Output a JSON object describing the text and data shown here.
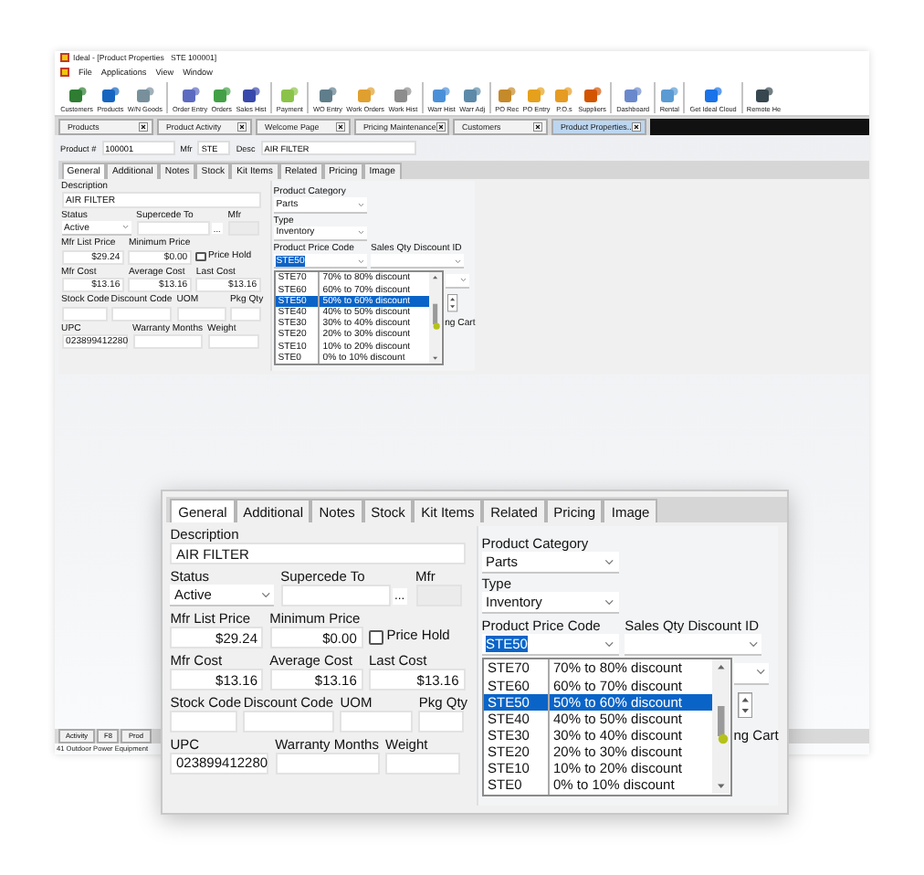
{
  "window": {
    "title": "Ideal - [Product Properties   STE 100001]",
    "menu": [
      "File",
      "Applications",
      "View",
      "Window"
    ],
    "toolbar_groups": [
      [
        "Customers",
        "Products",
        "W/N Goods"
      ],
      [
        "Order Entry",
        "Orders",
        "Sales Hist"
      ],
      [
        "Payment"
      ],
      [
        "WO Entry",
        "Work Orders",
        "Work Hist"
      ],
      [
        "Warr Hist",
        "Warr Adj"
      ],
      [
        "PO Rec",
        "PO Entry",
        "P.O.s",
        "Suppliers"
      ],
      [
        "Dashboard"
      ],
      [
        "Rental"
      ],
      [
        "Get Ideal Cloud"
      ],
      [
        "Remote He"
      ]
    ],
    "doc_tabs": [
      {
        "label": "Products",
        "selected": false
      },
      {
        "label": "Product Activity",
        "selected": false
      },
      {
        "label": "Welcome Page",
        "selected": false
      },
      {
        "label": "Pricing Maintenance",
        "selected": false
      },
      {
        "label": "Customers",
        "selected": false
      },
      {
        "label": "Product Properties..",
        "selected": true
      }
    ],
    "product_bar": {
      "product_label": "Product #",
      "product_value": "100001",
      "mfr_label": "Mfr",
      "mfr_value": "STE",
      "desc_label": "Desc",
      "desc_value": "AIR FILTER"
    },
    "form": {
      "tabs": [
        {
          "label": "General",
          "selected": true
        },
        {
          "label": "Additional",
          "selected": false
        },
        {
          "label": "Notes",
          "selected": false
        },
        {
          "label": "Stock",
          "selected": false
        },
        {
          "label": "Kit Items",
          "selected": false
        },
        {
          "label": "Related",
          "selected": false
        },
        {
          "label": "Pricing",
          "selected": false
        },
        {
          "label": "Image",
          "selected": false
        }
      ],
      "description": {
        "label": "Description",
        "value": "AIR FILTER"
      },
      "status": {
        "label": "Status",
        "value": "Active"
      },
      "supercede_to": {
        "label": "Supercede To",
        "button": "..."
      },
      "mfr": {
        "label": "Mfr"
      },
      "mfr_list_price": {
        "label": "Mfr List Price",
        "value": "$29.24"
      },
      "minimum_price": {
        "label": "Minimum Price",
        "value": "$0.00"
      },
      "price_hold": {
        "label": "Price Hold",
        "checked": false
      },
      "mfr_cost": {
        "label": "Mfr Cost",
        "value": "$13.16"
      },
      "average_cost": {
        "label": "Average Cost",
        "value": "$13.16"
      },
      "last_cost": {
        "label": "Last Cost",
        "value": "$13.16"
      },
      "stock_code": {
        "label": "Stock Code"
      },
      "discount_code": {
        "label": "Discount Code"
      },
      "uom": {
        "label": "UOM"
      },
      "pkg_qty": {
        "label": "Pkg Qty"
      },
      "upc": {
        "label": "UPC",
        "value": "023899412280"
      },
      "warranty_months": {
        "label": "Warranty Months"
      },
      "weight": {
        "label": "Weight"
      },
      "product_category": {
        "label": "Product Category",
        "value": "Parts"
      },
      "type": {
        "label": "Type",
        "value": "Inventory"
      },
      "product_price_code": {
        "label": "Product Price Code",
        "value": "STE50"
      },
      "sales_qty_discount_id": {
        "label": "Sales Qty Discount ID"
      },
      "price_code_options": [
        {
          "code": "STE70",
          "description": "70% to 80% discount",
          "selected": false
        },
        {
          "code": "STE60",
          "description": "60% to 70% discount",
          "selected": false
        },
        {
          "code": "STE50",
          "description": "50% to 60% discount",
          "selected": true
        },
        {
          "code": "STE40",
          "description": "40% to 50% discount",
          "selected": false
        },
        {
          "code": "STE30",
          "description": "30% to 40% discount",
          "selected": false
        },
        {
          "code": "STE20",
          "description": "20% to 30% discount",
          "selected": false
        },
        {
          "code": "STE10",
          "description": "10% to 20% discount",
          "selected": false
        },
        {
          "code": "STE0",
          "description": "0% to 10% discount",
          "selected": false
        }
      ],
      "cart_label": "ng Cart"
    },
    "bottom_tabs": [
      "Activity",
      "F8",
      "Prod"
    ],
    "status_bar": "41 Outdoor Power Equipment"
  },
  "zoom_inset": {
    "form": {
      "tabs": [
        {
          "label": "General",
          "selected": true
        },
        {
          "label": "Additional",
          "selected": false
        },
        {
          "label": "Notes",
          "selected": false
        },
        {
          "label": "Stock",
          "selected": false
        },
        {
          "label": "Kit Items",
          "selected": false
        },
        {
          "label": "Related",
          "selected": false
        },
        {
          "label": "Pricing",
          "selected": false
        },
        {
          "label": "Image",
          "selected": false
        }
      ],
      "description": {
        "label": "Description",
        "value": "AIR FILTER"
      },
      "status": {
        "label": "Status",
        "value": "Active"
      },
      "supercede_to": {
        "label": "Supercede To",
        "button": "..."
      },
      "mfr": {
        "label": "Mfr"
      },
      "mfr_list_price": {
        "label": "Mfr List Price",
        "value": "$29.24"
      },
      "minimum_price": {
        "label": "Minimum Price",
        "value": "$0.00"
      },
      "price_hold": {
        "label": "Price Hold",
        "checked": false
      },
      "mfr_cost": {
        "label": "Mfr Cost",
        "value": "$13.16"
      },
      "average_cost": {
        "label": "Average Cost",
        "value": "$13.16"
      },
      "last_cost": {
        "label": "Last Cost",
        "value": "$13.16"
      },
      "stock_code": {
        "label": "Stock Code"
      },
      "discount_code": {
        "label": "Discount Code"
      },
      "uom": {
        "label": "UOM"
      },
      "pkg_qty": {
        "label": "Pkg Qty"
      },
      "upc": {
        "label": "UPC",
        "value": "023899412280"
      },
      "warranty_months": {
        "label": "Warranty Months"
      },
      "weight": {
        "label": "Weight"
      },
      "product_category": {
        "label": "Product Category",
        "value": "Parts"
      },
      "type": {
        "label": "Type",
        "value": "Inventory"
      },
      "product_price_code": {
        "label": "Product Price Code",
        "value": "STE50"
      },
      "sales_qty_discount_id": {
        "label": "Sales Qty Discount ID"
      },
      "price_code_options": [
        {
          "code": "STE70",
          "description": "70% to 80% discount",
          "selected": false
        },
        {
          "code": "STE60",
          "description": "60% to 70% discount",
          "selected": false
        },
        {
          "code": "STE50",
          "description": "50% to 60% discount",
          "selected": true
        },
        {
          "code": "STE40",
          "description": "40% to 50% discount",
          "selected": false
        },
        {
          "code": "STE30",
          "description": "30% to 40% discount",
          "selected": false
        },
        {
          "code": "STE20",
          "description": "20% to 30% discount",
          "selected": false
        },
        {
          "code": "STE10",
          "description": "10% to 20% discount",
          "selected": false
        },
        {
          "code": "STE0",
          "description": "0% to 10% discount",
          "selected": false
        }
      ],
      "cart_label": "ng Cart"
    }
  }
}
